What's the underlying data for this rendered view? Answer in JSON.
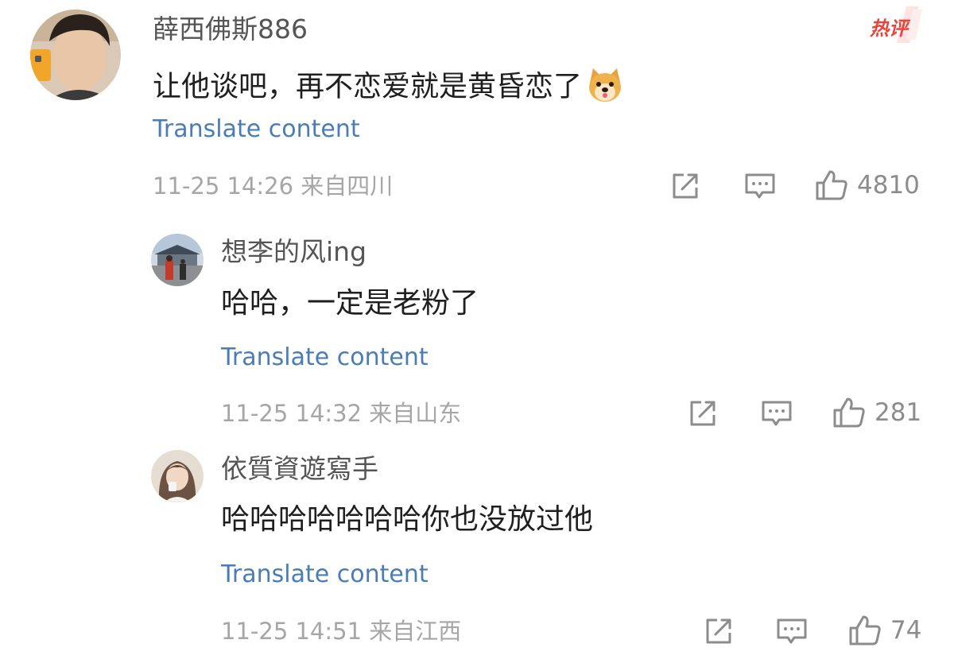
{
  "badge": {
    "label": "热评",
    "color": "#e8453c"
  },
  "comments": [
    {
      "username": "薛西佛斯886",
      "text": "让他谈吧，再不恋爱就是黄昏恋了",
      "emoji": "dog-face-emoji",
      "translate": "Translate content",
      "time": "11-25 14:26",
      "location": "来自四川",
      "likes": "4810",
      "meta": "11-25 14:26 来自四川"
    },
    {
      "username": "想李的风ing",
      "text": "哈哈，一定是老粉了",
      "translate": "Translate content",
      "time": "11-25 14:32",
      "location": "来自山东",
      "likes": "281",
      "meta": "11-25 14:32 来自山东"
    },
    {
      "username": "依質資遊寫手",
      "text": "哈哈哈哈哈哈哈你也没放过他",
      "translate": "Translate content",
      "time": "11-25 14:51",
      "location": "来自江西",
      "likes": "74",
      "meta": "11-25 14:51 来自江西"
    }
  ],
  "icons": {
    "share": "share-icon",
    "reply": "comment-icon",
    "like": "thumbs-up-icon"
  },
  "colors": {
    "link": "#4a7db5",
    "meta": "#a6a6a6",
    "icon": "#8c8c8c"
  }
}
